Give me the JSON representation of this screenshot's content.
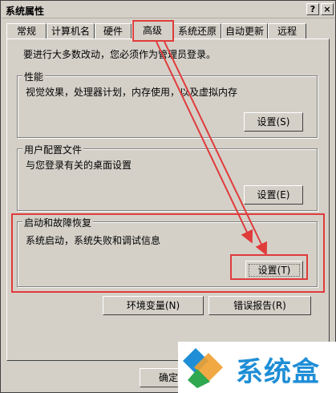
{
  "window": {
    "title": "系统属性"
  },
  "titlebar_buttons": {
    "help": "?",
    "close": "×"
  },
  "tabs": [
    {
      "label": "常规"
    },
    {
      "label": "计算机名"
    },
    {
      "label": "硬件"
    },
    {
      "label": "高级"
    },
    {
      "label": "系统还原"
    },
    {
      "label": "自动更新"
    },
    {
      "label": "远程"
    }
  ],
  "advanced": {
    "admin_note": "要进行大多数改动，您必须作为管理员登录。",
    "performance": {
      "title": "性能",
      "description": "视觉效果，处理器计划，内存使用，以及虚拟内存",
      "button": "设置(S)"
    },
    "user_profiles": {
      "title": "用户配置文件",
      "description": "与您登录有关的桌面设置",
      "button": "设置(E)"
    },
    "startup_recovery": {
      "title": "启动和故障恢复",
      "description": "系统启动，系统失败和调试信息",
      "button": "设置(T)"
    },
    "env_vars_button": "环境变量(N)",
    "error_report_button": "错误报告(R)"
  },
  "footer": {
    "ok_button": "确定"
  },
  "watermark": {
    "text": "系统盒"
  },
  "colors": {
    "highlight": "#e03b3b",
    "watermark": "#1f8ed6"
  }
}
